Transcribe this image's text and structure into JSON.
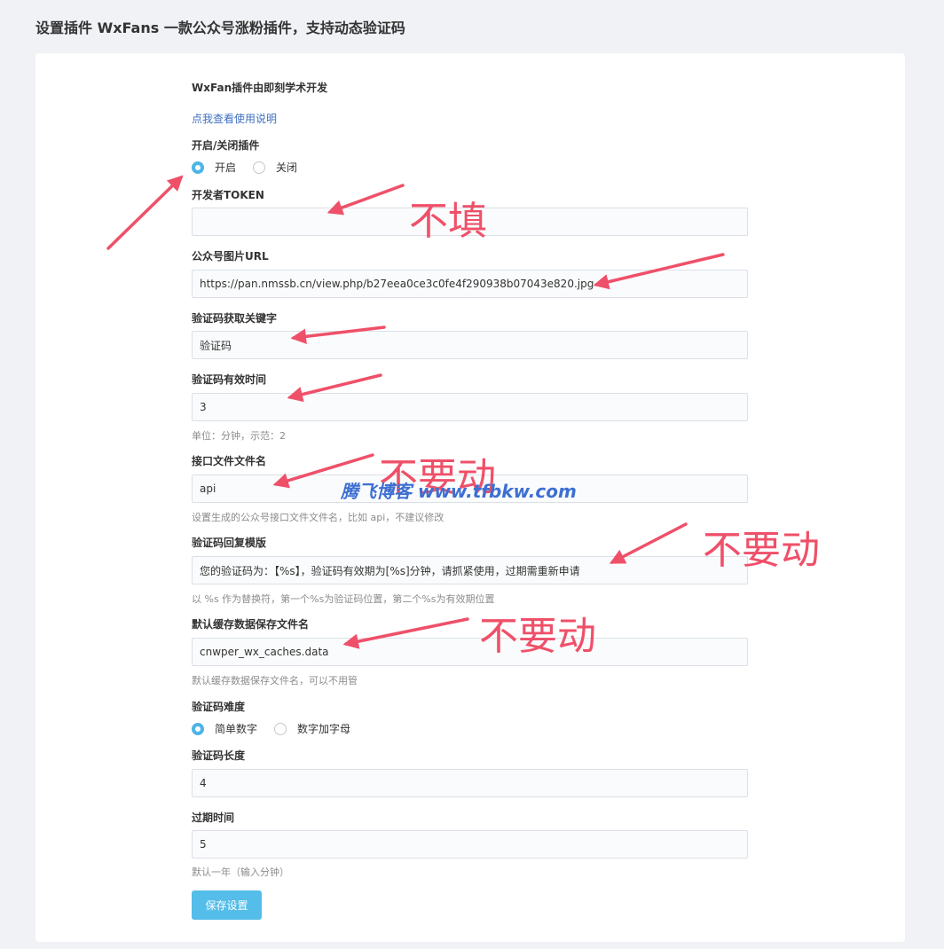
{
  "page": {
    "title": "设置插件 WxFans 一款公众号涨粉插件，支持动态验证码"
  },
  "intro": {
    "developer_note": "WxFan插件由即刻学术开发",
    "help_link": "点我查看使用说明"
  },
  "plugin_switch": {
    "label": "开启/关闭插件",
    "options": [
      "开启",
      "关闭"
    ],
    "selected": "开启"
  },
  "fields": {
    "token": {
      "label": "开发者TOKEN",
      "value": ""
    },
    "image_url": {
      "label": "公众号图片URL",
      "value": "https://pan.nmssb.cn/view.php/b27eea0ce3c0fe4f290938b07043e820.jpg"
    },
    "keyword": {
      "label": "验证码获取关键字",
      "value": "验证码"
    },
    "valid_time": {
      "label": "验证码有效时间",
      "value": "3",
      "hint": "单位：分钟，示范：2"
    },
    "api_filename": {
      "label": "接口文件文件名",
      "value": "api",
      "hint": "设置生成的公众号接口文件文件名，比如 api，不建议修改"
    },
    "reply_template": {
      "label": "验证码回复模版",
      "value": "您的验证码为：【%s】，验证码有效期为[%s]分钟，请抓紧使用，过期需重新申请",
      "hint": "以 %s 作为替换符，第一个%s为验证码位置，第二个%s为有效期位置"
    },
    "cache_filename": {
      "label": "默认缓存数据保存文件名",
      "value": "cnwper_wx_caches.data",
      "hint": "默认缓存数据保存文件名，可以不用管"
    },
    "code_length": {
      "label": "验证码长度",
      "value": "4"
    },
    "expire_time": {
      "label": "过期时间",
      "value": "5",
      "hint": "默认一年（输入分钟）"
    }
  },
  "difficulty": {
    "label": "验证码难度",
    "options": [
      "简单数字",
      "数字加字母"
    ],
    "selected": "简单数字"
  },
  "actions": {
    "save_label": "保存设置"
  },
  "annotations": {
    "no_fill": "不填",
    "do_not_change": "不要动",
    "watermark": "腾飞博客 www.tfbkw.com",
    "color": "#ef5069"
  },
  "colors": {
    "accent": "#54bde9",
    "link": "#3e6fc1",
    "background": "#f0f2f5"
  }
}
